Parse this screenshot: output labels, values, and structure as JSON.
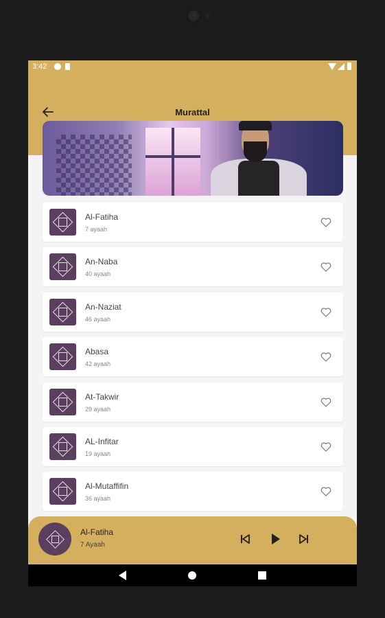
{
  "status_bar": {
    "time": "3:42"
  },
  "header": {
    "title": "Murattal"
  },
  "surahs": [
    {
      "name": "Al-Fatiha",
      "ayahs": "7 ayaah"
    },
    {
      "name": "An-Naba",
      "ayahs": "40 ayaah"
    },
    {
      "name": "An-Naziat",
      "ayahs": "46 ayaah"
    },
    {
      "name": "Abasa",
      "ayahs": "42 ayaah"
    },
    {
      "name": "At-Takwir",
      "ayahs": "29 ayaah"
    },
    {
      "name": "AL-Infitar",
      "ayahs": "19 ayaah"
    },
    {
      "name": "Al-Mutaffifin",
      "ayahs": "36 ayaah"
    }
  ],
  "player": {
    "title": "Al-Fatiha",
    "subtitle": "7 Ayaah"
  },
  "icons": {
    "back": "arrow-left-icon",
    "favorite": "heart-outline-icon",
    "prev": "skip-previous-icon",
    "play": "play-icon",
    "next": "skip-next-icon"
  },
  "colors": {
    "accent": "#d4af5e",
    "thumb": "#5a3f5e",
    "background": "#f4f4f4"
  }
}
